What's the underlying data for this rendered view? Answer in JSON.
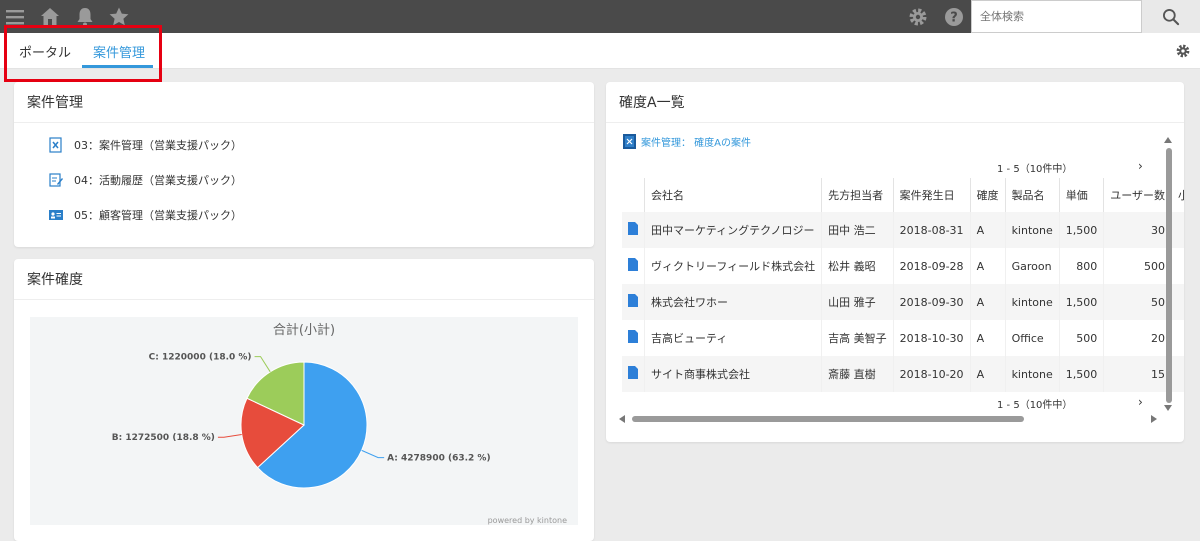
{
  "header": {
    "search": {
      "placeholder": "全体検索"
    }
  },
  "tabs": [
    {
      "label": "ポータル"
    },
    {
      "label": "案件管理",
      "active": true
    }
  ],
  "apps_panel": {
    "title": "案件管理",
    "items": [
      {
        "label": "03：案件管理（営業支援パック）",
        "icon": "app-document-icon"
      },
      {
        "label": "04：活動履歴（営業支援パック）",
        "icon": "app-edit-icon"
      },
      {
        "label": "05：顧客管理（営業支援パック）",
        "icon": "app-id-card-icon"
      }
    ]
  },
  "chart_panel": {
    "title": "案件確度",
    "powered_by": "powered by kintone"
  },
  "chart_data": {
    "type": "pie",
    "title": "合計(小計)",
    "slices": [
      {
        "label": "A",
        "value": 4278900,
        "percent": 63.2,
        "text": "A: 4278900 (63.2 %)",
        "color": "#3ea0f0"
      },
      {
        "label": "B",
        "value": 1272500,
        "percent": 18.8,
        "text": "B: 1272500 (18.8 %)",
        "color": "#e74c3c"
      },
      {
        "label": "C",
        "value": 1220000,
        "percent": 18.0,
        "text": "C: 1220000 (18.0 %)",
        "color": "#9ccc5a"
      }
    ]
  },
  "table_panel": {
    "title": "確度A一覧",
    "view_link": "案件管理： 確度Aの案件",
    "pager_top": "1 - 5（10件中）",
    "pager_bottom": "1 - 5（10件中）",
    "next_symbol": "›",
    "columns": [
      "会社名",
      "先方担当者",
      "案件発生日",
      "確度",
      "製品名",
      "単価",
      "ユーザー数",
      "小"
    ],
    "rows": [
      {
        "company": "田中マーケティングテクノロジー",
        "contact": "田中 浩二",
        "date": "2018-08-31",
        "rank": "A",
        "product": "kintone",
        "price": "1,500",
        "users": "30"
      },
      {
        "company": "ヴィクトリーフィールド株式会社",
        "contact": "松井 義昭",
        "date": "2018-09-28",
        "rank": "A",
        "product": "Garoon",
        "price": "800",
        "users": "500"
      },
      {
        "company": "株式会社ワホー",
        "contact": "山田 雅子",
        "date": "2018-09-30",
        "rank": "A",
        "product": "kintone",
        "price": "1,500",
        "users": "50"
      },
      {
        "company": "吉高ビューティ",
        "contact": "吉高 美智子",
        "date": "2018-10-30",
        "rank": "A",
        "product": "Office",
        "price": "500",
        "users": "20"
      },
      {
        "company": "サイト商事株式会社",
        "contact": "斎藤 直樹",
        "date": "2018-10-20",
        "rank": "A",
        "product": "kintone",
        "price": "1,500",
        "users": "15"
      }
    ]
  },
  "colors": {
    "accent": "#3498db",
    "header_bg": "#4a4a4a",
    "highlight": "#e60012"
  }
}
